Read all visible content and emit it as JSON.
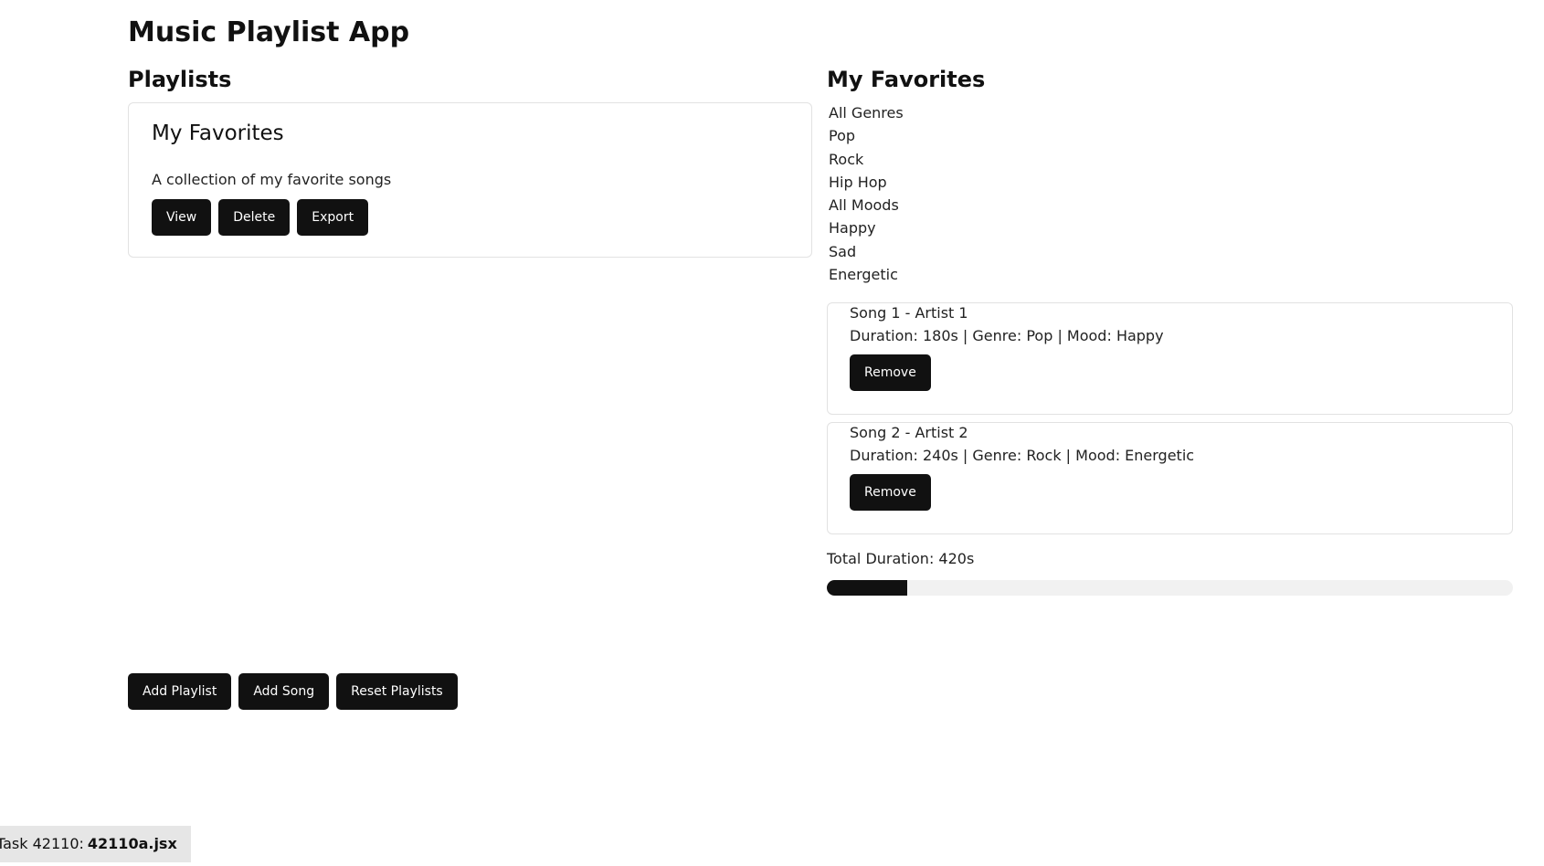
{
  "app": {
    "title": "Music Playlist App"
  },
  "playlists": {
    "heading": "Playlists",
    "items": [
      {
        "name": "My Favorites",
        "description": "A collection of my favorite songs",
        "actions": [
          "View",
          "Delete",
          "Export"
        ]
      }
    ]
  },
  "detail": {
    "heading": "My Favorites",
    "genre_options": [
      "All Genres",
      "Pop",
      "Rock",
      "Hip Hop"
    ],
    "mood_options": [
      "All Moods",
      "Happy",
      "Sad",
      "Energetic"
    ],
    "songs": [
      {
        "title": "Song 1 - Artist 1",
        "meta": "Duration: 180s | Genre: Pop | Mood: Happy",
        "remove_label": "Remove"
      },
      {
        "title": "Song 2 - Artist 2",
        "meta": "Duration: 240s | Genre: Rock | Mood: Energetic",
        "remove_label": "Remove"
      }
    ],
    "total_label": "Total Duration: 420s",
    "progress_fraction": 0.117
  },
  "bottom_actions": [
    "Add Playlist",
    "Add Song",
    "Reset Playlists"
  ],
  "footer": {
    "task_label": "Task 42110:",
    "file": "42110a.jsx"
  },
  "colors": {
    "button_bg": "#111111",
    "border": "#e2e2e2",
    "progress_track": "#f1f1f1"
  }
}
